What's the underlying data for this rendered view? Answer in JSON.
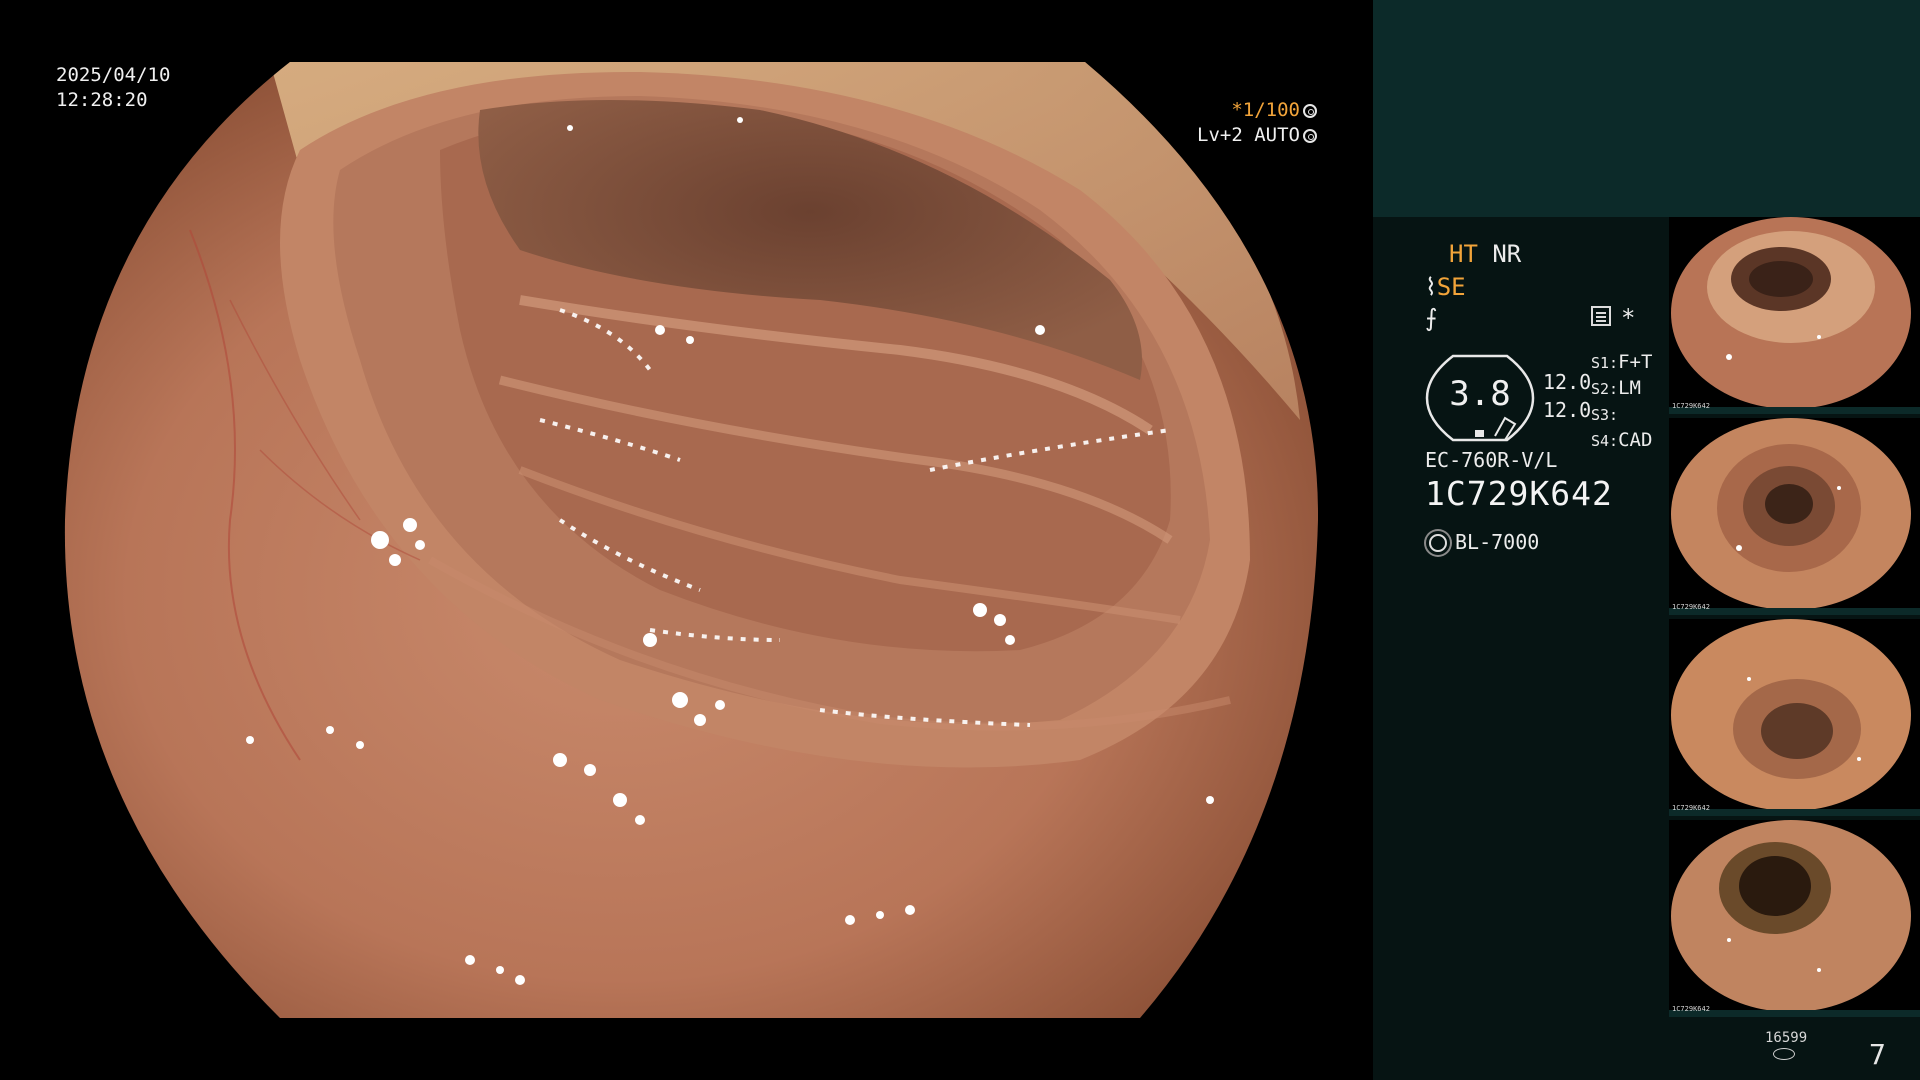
{
  "overlay": {
    "date": "2025/04/10",
    "time": "12:28:20",
    "shutter": "*1/100",
    "level": "Lv+2 AUTO"
  },
  "panel": {
    "ht": "HT",
    "nr": "NR",
    "se": "SE",
    "gauge_value": "3.8",
    "readings": [
      "12.0",
      "12.0"
    ],
    "settings": [
      {
        "key": "S1:",
        "value": "F+T"
      },
      {
        "key": "S2:",
        "value": "LM"
      },
      {
        "key": "S3:",
        "value": ""
      },
      {
        "key": "S4:",
        "value": "CAD"
      }
    ],
    "asterisk": "*",
    "scope_model": "EC-760R-V/L",
    "serial": "1C729K642",
    "light_source": "BL-7000"
  },
  "thumbnails": [
    {
      "label": "1C729K642"
    },
    {
      "label": "1C729K642"
    },
    {
      "label": "1C729K642"
    },
    {
      "label": "1C729K642"
    }
  ],
  "footer": {
    "count": "16599",
    "page": "7"
  },
  "colors": {
    "accent_orange": "#f2a43a",
    "panel_bg": "#061413",
    "panel_header_bg": "#0c2a29",
    "mucosa": "#c8876a"
  }
}
